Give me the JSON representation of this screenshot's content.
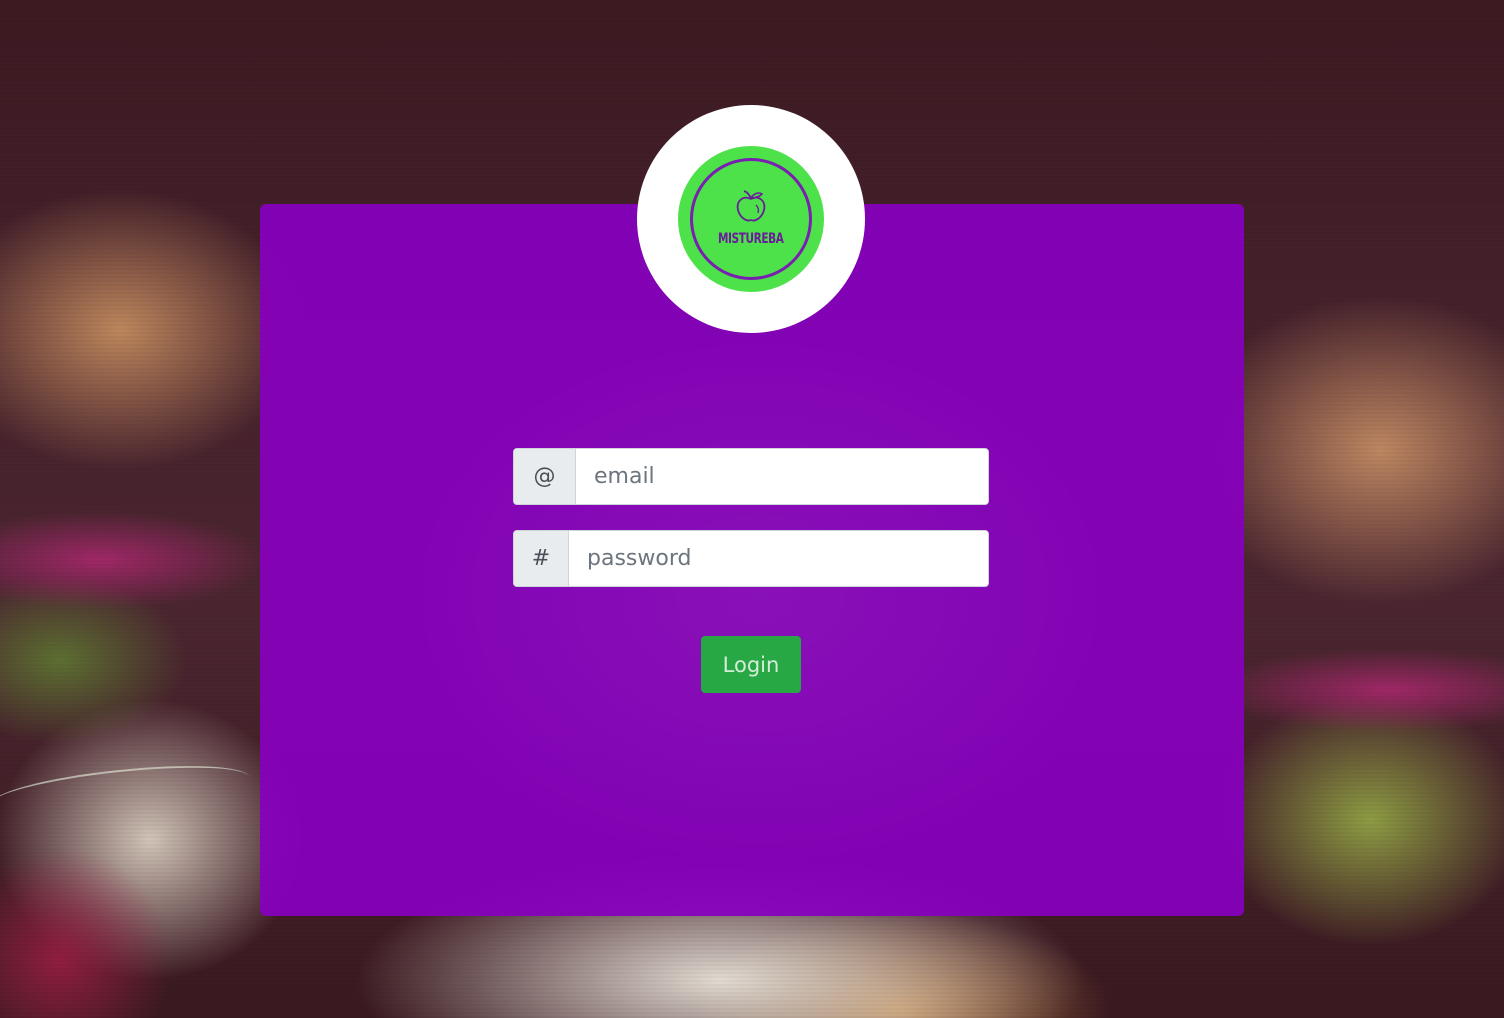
{
  "logo": {
    "text": "MISTUREBA",
    "icon": "fruit-icon"
  },
  "form": {
    "email": {
      "addon": "@",
      "placeholder": "email",
      "value": ""
    },
    "password": {
      "addon": "#",
      "placeholder": "password",
      "value": ""
    },
    "submit_label": "Login"
  },
  "colors": {
    "card": "#8600be",
    "logo_green": "#4de24a",
    "button": "#28a745"
  }
}
